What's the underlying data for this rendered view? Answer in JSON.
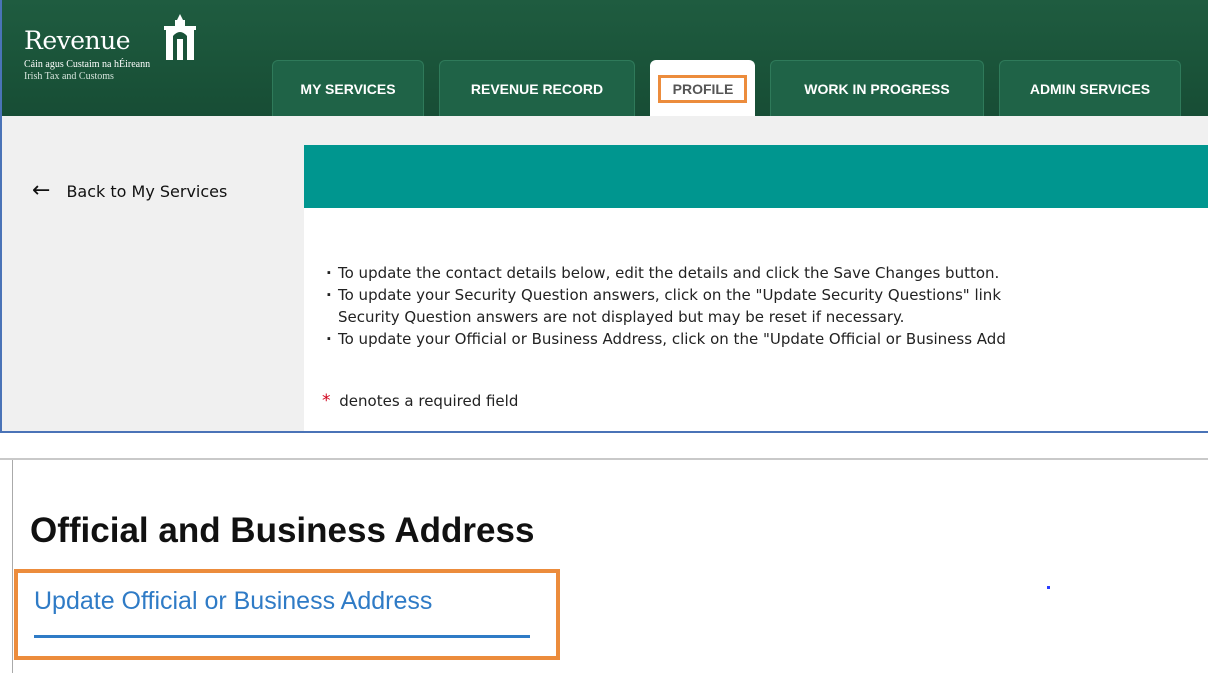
{
  "brand": {
    "name": "Revenue",
    "subtitle_irish": "Cáin agus Custaim na hÉireann",
    "subtitle_english": "Irish Tax and Customs"
  },
  "nav": {
    "tabs": [
      {
        "label": "MY SERVICES",
        "active": false
      },
      {
        "label": "REVENUE RECORD",
        "active": false
      },
      {
        "label": "PROFILE",
        "active": true
      },
      {
        "label": "WORK IN PROGRESS",
        "active": false
      },
      {
        "label": "ADMIN SERVICES",
        "active": false
      }
    ]
  },
  "sidebar": {
    "back_icon": "arrow-left-icon",
    "back_label": "Back to My Services"
  },
  "content": {
    "instructions": [
      "To update the contact details below, edit the details and click the Save Changes button.",
      "To update your Security Question answers, click on the \"Update Security Questions\" link",
      "Security Question answers are not displayed but may be reset if necessary.",
      "To update your Official or Business Address, click on the \"Update Official or Business Add"
    ],
    "required_star": "*",
    "required_note": "denotes a required field"
  },
  "section": {
    "heading": "Official and Business Address",
    "update_link": "Update Official or Business Address"
  },
  "colors": {
    "header_green": "#1a5339",
    "teal_bar": "#00968f",
    "highlight_orange": "#ec8c3c",
    "link_blue": "#2f7bc6",
    "required_red": "#d0021b"
  }
}
